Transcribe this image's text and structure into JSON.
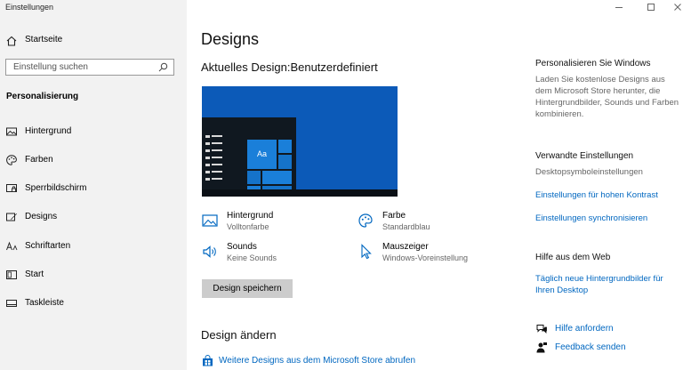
{
  "window": {
    "title": "Einstellungen"
  },
  "sidebar": {
    "home_label": "Startseite",
    "search_placeholder": "Einstellung suchen",
    "section_title": "Personalisierung",
    "items": [
      {
        "label": "Hintergrund",
        "icon": "image-icon"
      },
      {
        "label": "Farben",
        "icon": "palette-icon"
      },
      {
        "label": "Sperrbildschirm",
        "icon": "lock-screen-icon"
      },
      {
        "label": "Designs",
        "icon": "designs-icon"
      },
      {
        "label": "Schriftarten",
        "icon": "fonts-icon"
      },
      {
        "label": "Start",
        "icon": "start-icon"
      },
      {
        "label": "Taskleiste",
        "icon": "taskbar-icon"
      }
    ]
  },
  "main": {
    "title": "Designs",
    "current_design_heading": "Aktuelles Design:Benutzerdefiniert",
    "preview_tile_label": "Aa",
    "settings": [
      {
        "title": "Hintergrund",
        "value": "Volltonfarbe",
        "icon": "image-icon"
      },
      {
        "title": "Farbe",
        "value": "Standardblau",
        "icon": "palette-icon"
      },
      {
        "title": "Sounds",
        "value": "Keine Sounds",
        "icon": "speaker-icon"
      },
      {
        "title": "Mauszeiger",
        "value": "Windows-Voreinstellung",
        "icon": "cursor-icon"
      }
    ],
    "save_button": "Design speichern",
    "change_design_heading": "Design ändern",
    "store_link": "Weitere Designs aus dem Microsoft Store abrufen"
  },
  "right": {
    "personalize_heading": "Personalisieren Sie Windows",
    "personalize_text": "Laden Sie kostenlose Designs aus dem Microsoft Store herunter, die Hintergrundbilder, Sounds und Farben kombinieren.",
    "related_heading": "Verwandte Einstellungen",
    "related_items": [
      "Desktopsymboleinstellungen",
      "Einstellungen für hohen Kontrast",
      "Einstellungen synchronisieren"
    ],
    "web_help_heading": "Hilfe aus dem Web",
    "web_help_link": "Täglich neue Hintergrundbilder für Ihren Desktop",
    "help_link": "Hilfe anfordern",
    "feedback_link": "Feedback senden"
  },
  "colors": {
    "accent": "#0067c0",
    "preview_bg": "#0c5ab8",
    "tile": "#1a7fd9"
  }
}
